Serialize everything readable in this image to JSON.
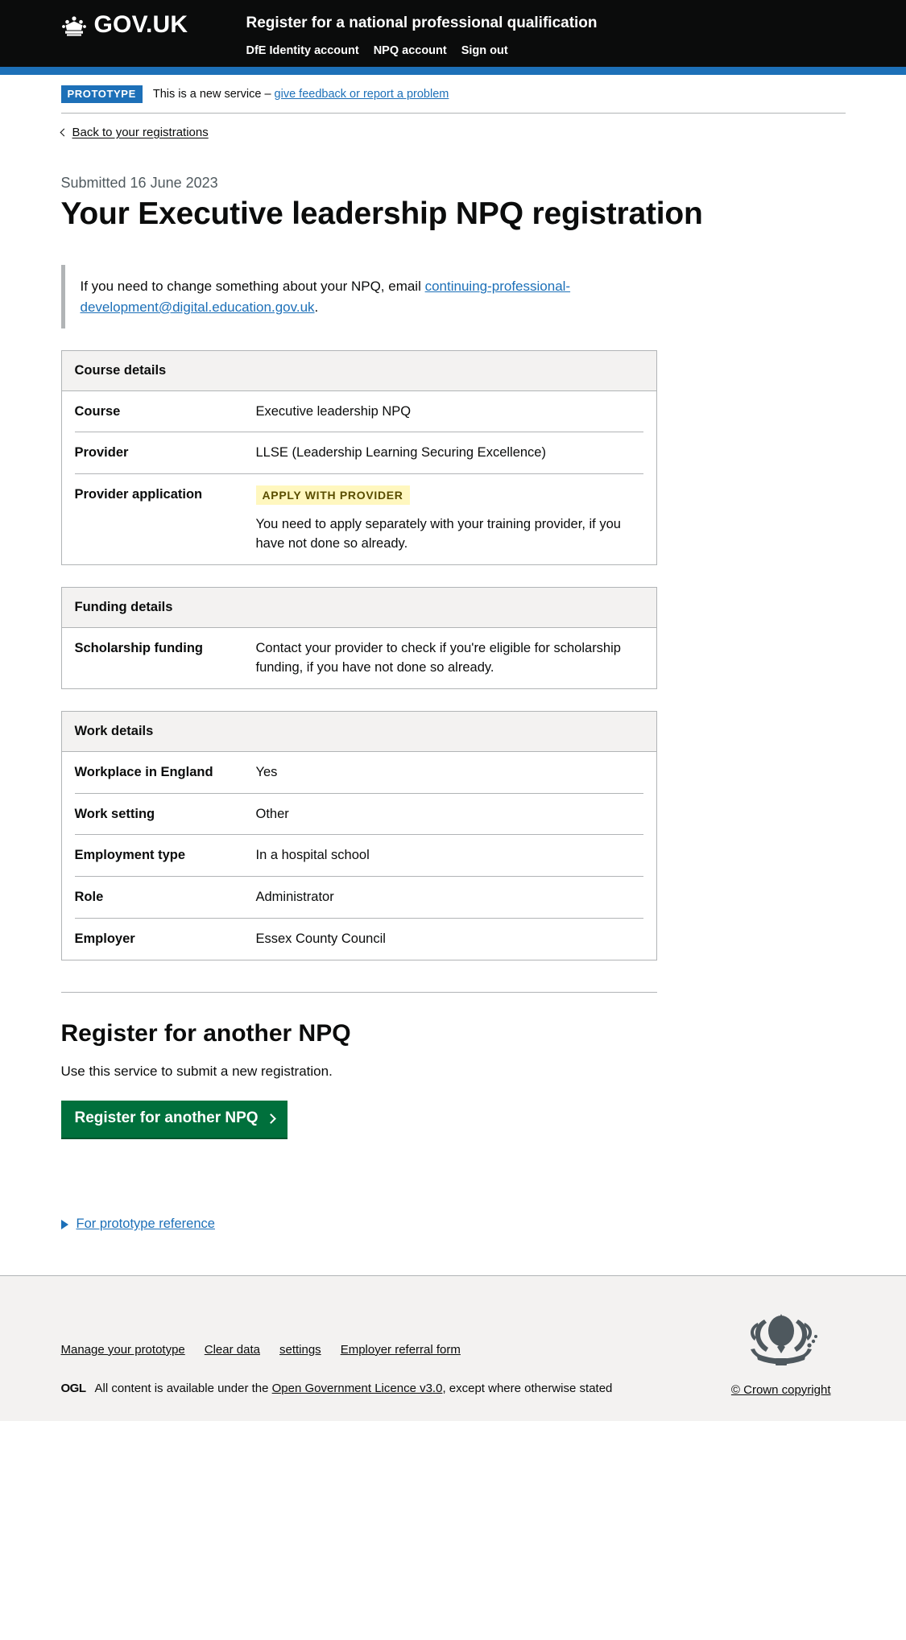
{
  "header": {
    "logo_text": "GOV.UK",
    "logo_icon": "crown-icon",
    "service_name": "Register for a national professional qualification",
    "nav": [
      {
        "label": "DfE Identity account"
      },
      {
        "label": "NPQ account"
      },
      {
        "label": "Sign out"
      }
    ]
  },
  "phase_banner": {
    "tag": "PROTOTYPE",
    "text_before": "This is a new service –",
    "link": "give feedback or report a problem"
  },
  "back_link": {
    "label": "Back to your registrations",
    "icon": "chevron-left-icon"
  },
  "page": {
    "caption": "Submitted 16 June 2023",
    "title": "Your Executive leadership NPQ registration"
  },
  "inset": {
    "text_before": "If you need to change something about your NPQ, email ",
    "email": "continuing-professional-development@digital.education.gov.uk",
    "text_after": "."
  },
  "cards": [
    {
      "title": "Course details",
      "rows": [
        {
          "key": "Course",
          "value": "Executive leadership NPQ"
        },
        {
          "key": "Provider",
          "value": "LLSE (Leadership Learning Securing Excellence)"
        },
        {
          "key": "Provider application",
          "tag": "APPLY WITH PROVIDER",
          "value": "You need to apply separately with your training provider, if you have not done so already."
        }
      ]
    },
    {
      "title": "Funding details",
      "rows": [
        {
          "key": "Scholarship funding",
          "value": "Contact your provider to check if you're eligible for scholarship funding, if you have not done so already."
        }
      ]
    },
    {
      "title": "Work details",
      "rows": [
        {
          "key": "Workplace in England",
          "value": "Yes"
        },
        {
          "key": "Work setting",
          "value": "Other"
        },
        {
          "key": "Employment type",
          "value": "In a hospital school"
        },
        {
          "key": "Role",
          "value": "Administrator"
        },
        {
          "key": "Employer",
          "value": "Essex County Council"
        }
      ]
    }
  ],
  "register_section": {
    "heading": "Register for another NPQ",
    "body": "Use this service to submit a new registration.",
    "button_label": "Register for another NPQ",
    "button_icon": "chevron-right-icon",
    "button_color": "#00703c"
  },
  "details": {
    "label": "For prototype reference",
    "icon": "triangle-right-icon"
  },
  "footer": {
    "links": [
      {
        "label": "Manage your prototype"
      },
      {
        "label": "Clear data"
      },
      {
        "label": "settings"
      },
      {
        "label": "Employer referral form"
      }
    ],
    "ogl_badge": "OGL",
    "licence_before": "All content is available under the ",
    "licence_link": "Open Government Licence v3.0",
    "licence_after": ", except where otherwise stated",
    "crown_icon": "royal-coat-of-arms-icon",
    "crown_copyright": "© Crown copyright"
  },
  "colors": {
    "brand_blue": "#1d70b8",
    "black": "#0b0c0c",
    "green": "#00703c",
    "tag_yellow_bg": "#fff7bf",
    "tag_yellow_text": "#594d00",
    "grey_light": "#f3f2f1",
    "grey_border": "#b1b4b6",
    "caption_grey": "#505a5f"
  }
}
